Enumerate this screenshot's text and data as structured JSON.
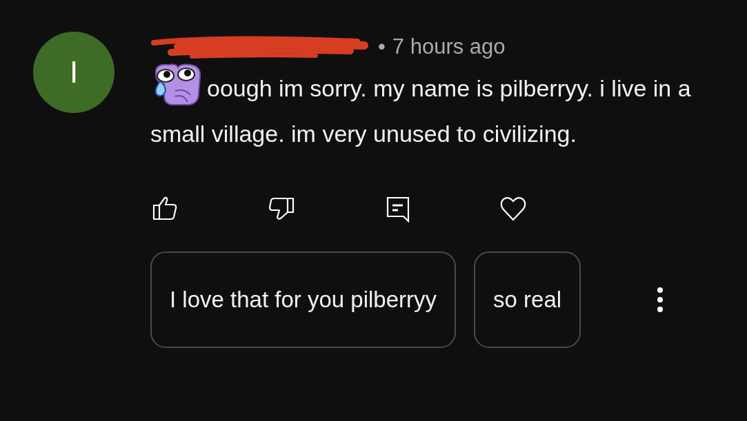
{
  "avatar": {
    "letter": "I",
    "color": "#3e6b25"
  },
  "comment": {
    "time": "7 hours ago",
    "separator": "•",
    "text": "oough im sorry. my name is pilberryy. i live in a small village. im very unused to civilizing."
  },
  "suggested_replies": [
    "I love that for you pilberryy",
    "so real"
  ]
}
